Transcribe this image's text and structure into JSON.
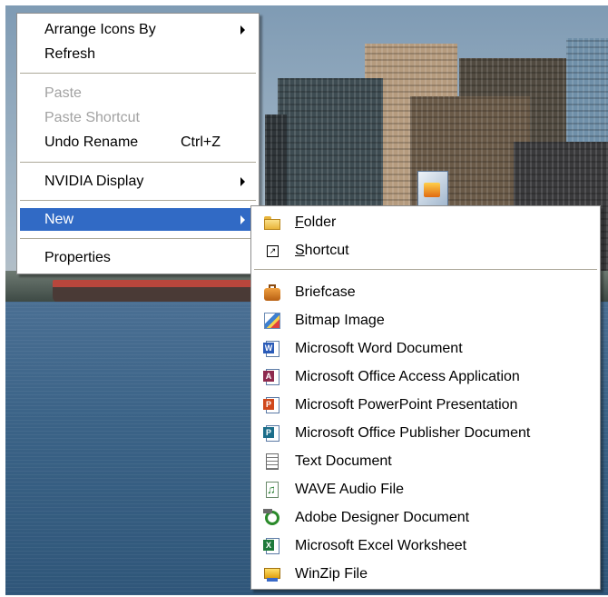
{
  "context_menu": {
    "items": [
      {
        "label": "Arrange Icons By",
        "has_submenu": true
      },
      {
        "label": "Refresh"
      },
      {
        "label": "Paste",
        "disabled": true
      },
      {
        "label": "Paste Shortcut",
        "disabled": true
      },
      {
        "label": "Undo Rename",
        "shortcut": "Ctrl+Z"
      },
      {
        "label": "NVIDIA Display",
        "has_submenu": true
      },
      {
        "label": "New",
        "has_submenu": true,
        "selected": true
      },
      {
        "label": "Properties"
      }
    ]
  },
  "new_submenu": {
    "folder": {
      "accel": "F",
      "rest": "older"
    },
    "shortcut": {
      "accel": "S",
      "rest": "hortcut"
    },
    "items": [
      {
        "label": "Briefcase",
        "icon": "briefcase-icon"
      },
      {
        "label": "Bitmap Image",
        "icon": "bitmap-image-icon"
      },
      {
        "label": "Microsoft Word Document",
        "icon": "word-document-icon"
      },
      {
        "label": "Microsoft Office Access Application",
        "icon": "access-application-icon"
      },
      {
        "label": "Microsoft PowerPoint Presentation",
        "icon": "powerpoint-presentation-icon"
      },
      {
        "label": "Microsoft Office Publisher Document",
        "icon": "publisher-document-icon"
      },
      {
        "label": "Text Document",
        "icon": "text-document-icon"
      },
      {
        "label": "WAVE Audio File",
        "icon": "wave-audio-icon"
      },
      {
        "label": "Adobe Designer Document",
        "icon": "adobe-designer-icon"
      },
      {
        "label": "Microsoft Excel Worksheet",
        "icon": "excel-worksheet-icon"
      },
      {
        "label": "WinZip File",
        "icon": "winzip-file-icon"
      }
    ]
  },
  "colors": {
    "selection": "#316ac5",
    "disabled_text": "#a2a2a2",
    "separator": "#aca899"
  }
}
